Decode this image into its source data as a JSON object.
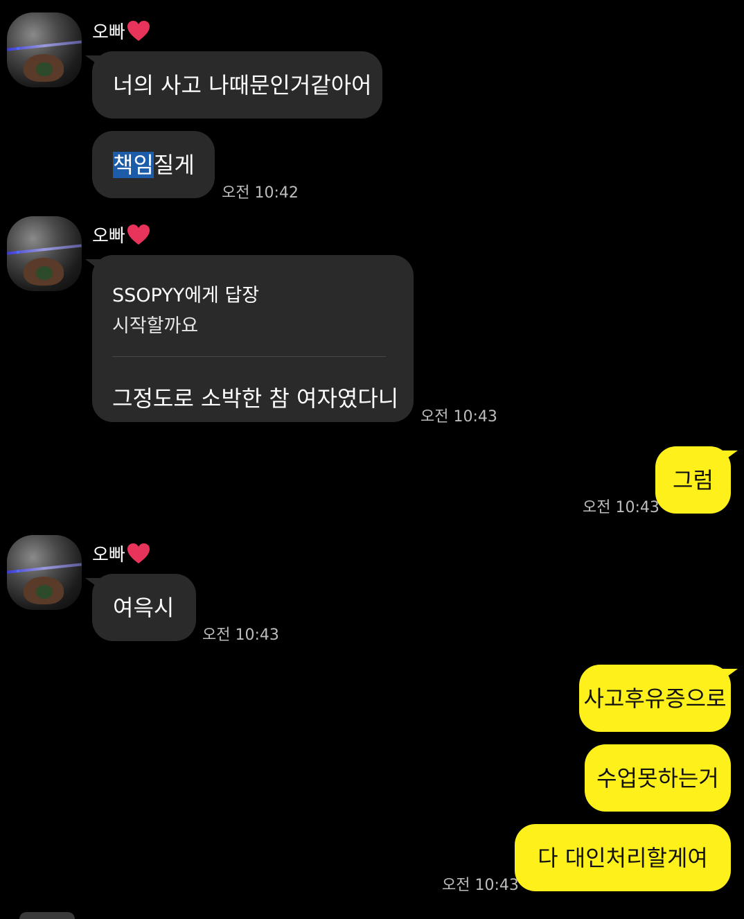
{
  "sender_name": "오빠",
  "messages": {
    "m1": "너의 사고 나때문인거같아어",
    "m2_hl": "책임",
    "m2_rest": "질게",
    "m2_time": "오전 10:42",
    "m3_reply_to": "SSOPYY에게 답장",
    "m3_quote": "시작할까요",
    "m3_text": "그정도로 소박한 참 여자였다니",
    "m3_time": "오전 10:43",
    "m4": "그럼",
    "m4_time": "오전 10:43",
    "m5": "여윽시",
    "m5_time": "오전 10:43",
    "m6": "사고후유증으로",
    "m7": "수업못하는거",
    "m8": "다 대인처리할게여",
    "m8_time": "오전 10:43"
  },
  "colors": {
    "background": "#000000",
    "other_bubble": "#2a2a2a",
    "my_bubble": "#fef01b",
    "heart": "#e8345a",
    "highlight": "#1d5ca8"
  },
  "icons": {
    "heart": "heart-icon"
  }
}
